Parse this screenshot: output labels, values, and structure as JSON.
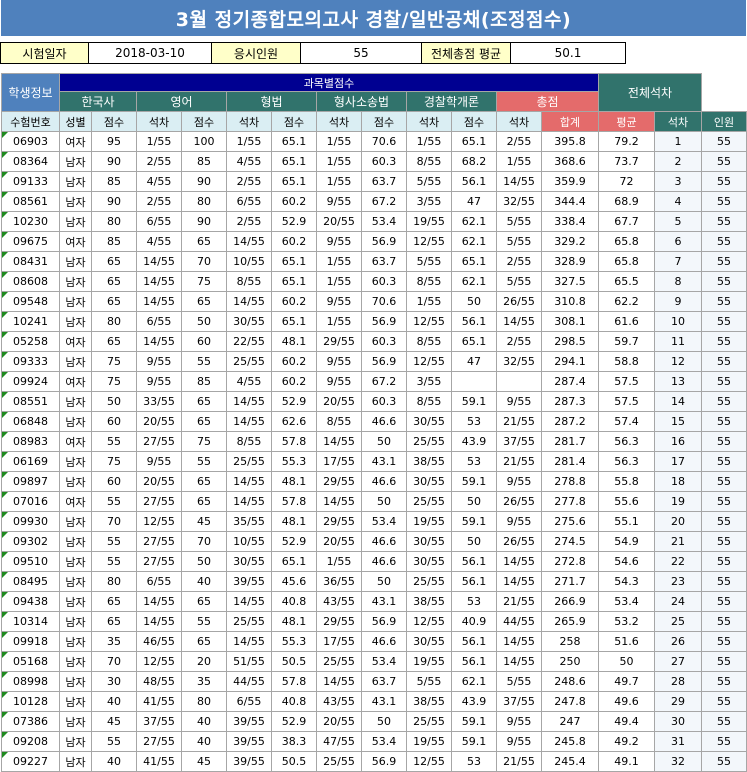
{
  "title": "3월 정기종합모의고사 경찰/일반공채(조정점수)",
  "info": {
    "exam_date_label": "시험일자",
    "exam_date": "2018-03-10",
    "count_label": "응시인원",
    "count": "55",
    "avg_label": "전체총점 평균",
    "avg": "50.1"
  },
  "headers": {
    "student_info": "학생정보",
    "subjects": "과목별점수",
    "overall_rank": "전체석차",
    "subject_names": [
      "한국사",
      "영어",
      "형법",
      "형사소송법",
      "경찰학개론"
    ],
    "total": "총점",
    "exam_no": "수험번호",
    "gender": "성별",
    "score": "점수",
    "rank": "석차",
    "sum": "합계",
    "average": "평균",
    "rank2": "석차",
    "people": "인원"
  },
  "rows": [
    [
      "06903",
      "여자",
      "95",
      "1/55",
      "100",
      "1/55",
      "65.1",
      "1/55",
      "70.6",
      "1/55",
      "65.1",
      "2/55",
      "395.8",
      "79.2",
      "1",
      "55"
    ],
    [
      "08364",
      "남자",
      "90",
      "2/55",
      "85",
      "4/55",
      "65.1",
      "1/55",
      "60.3",
      "8/55",
      "68.2",
      "1/55",
      "368.6",
      "73.7",
      "2",
      "55"
    ],
    [
      "09133",
      "남자",
      "85",
      "4/55",
      "90",
      "2/55",
      "65.1",
      "1/55",
      "63.7",
      "5/55",
      "56.1",
      "14/55",
      "359.9",
      "72",
      "3",
      "55"
    ],
    [
      "08561",
      "남자",
      "90",
      "2/55",
      "80",
      "6/55",
      "60.2",
      "9/55",
      "67.2",
      "3/55",
      "47",
      "32/55",
      "344.4",
      "68.9",
      "4",
      "55"
    ],
    [
      "10230",
      "남자",
      "80",
      "6/55",
      "90",
      "2/55",
      "52.9",
      "20/55",
      "53.4",
      "19/55",
      "62.1",
      "5/55",
      "338.4",
      "67.7",
      "5",
      "55"
    ],
    [
      "09675",
      "여자",
      "85",
      "4/55",
      "65",
      "14/55",
      "60.2",
      "9/55",
      "56.9",
      "12/55",
      "62.1",
      "5/55",
      "329.2",
      "65.8",
      "6",
      "55"
    ],
    [
      "08431",
      "남자",
      "65",
      "14/55",
      "70",
      "10/55",
      "65.1",
      "1/55",
      "63.7",
      "5/55",
      "65.1",
      "2/55",
      "328.9",
      "65.8",
      "7",
      "55"
    ],
    [
      "08608",
      "남자",
      "65",
      "14/55",
      "75",
      "8/55",
      "65.1",
      "1/55",
      "60.3",
      "8/55",
      "62.1",
      "5/55",
      "327.5",
      "65.5",
      "8",
      "55"
    ],
    [
      "09548",
      "남자",
      "65",
      "14/55",
      "65",
      "14/55",
      "60.2",
      "9/55",
      "70.6",
      "1/55",
      "50",
      "26/55",
      "310.8",
      "62.2",
      "9",
      "55"
    ],
    [
      "10241",
      "남자",
      "80",
      "6/55",
      "50",
      "30/55",
      "65.1",
      "1/55",
      "56.9",
      "12/55",
      "56.1",
      "14/55",
      "308.1",
      "61.6",
      "10",
      "55"
    ],
    [
      "05258",
      "여자",
      "65",
      "14/55",
      "60",
      "22/55",
      "48.1",
      "29/55",
      "60.3",
      "8/55",
      "65.1",
      "2/55",
      "298.5",
      "59.7",
      "11",
      "55"
    ],
    [
      "09333",
      "남자",
      "75",
      "9/55",
      "55",
      "25/55",
      "60.2",
      "9/55",
      "56.9",
      "12/55",
      "47",
      "32/55",
      "294.1",
      "58.8",
      "12",
      "55"
    ],
    [
      "09924",
      "여자",
      "75",
      "9/55",
      "85",
      "4/55",
      "60.2",
      "9/55",
      "67.2",
      "3/55",
      "",
      "",
      "287.4",
      "57.5",
      "13",
      "55"
    ],
    [
      "08551",
      "남자",
      "50",
      "33/55",
      "65",
      "14/55",
      "52.9",
      "20/55",
      "60.3",
      "8/55",
      "59.1",
      "9/55",
      "287.3",
      "57.5",
      "14",
      "55"
    ],
    [
      "06848",
      "남자",
      "60",
      "20/55",
      "65",
      "14/55",
      "62.6",
      "8/55",
      "46.6",
      "30/55",
      "53",
      "21/55",
      "287.2",
      "57.4",
      "15",
      "55"
    ],
    [
      "08983",
      "여자",
      "55",
      "27/55",
      "75",
      "8/55",
      "57.8",
      "14/55",
      "50",
      "25/55",
      "43.9",
      "37/55",
      "281.7",
      "56.3",
      "16",
      "55"
    ],
    [
      "06169",
      "남자",
      "75",
      "9/55",
      "55",
      "25/55",
      "55.3",
      "17/55",
      "43.1",
      "38/55",
      "53",
      "21/55",
      "281.4",
      "56.3",
      "17",
      "55"
    ],
    [
      "09897",
      "남자",
      "60",
      "20/55",
      "65",
      "14/55",
      "48.1",
      "29/55",
      "46.6",
      "30/55",
      "59.1",
      "9/55",
      "278.8",
      "55.8",
      "18",
      "55"
    ],
    [
      "07016",
      "여자",
      "55",
      "27/55",
      "65",
      "14/55",
      "57.8",
      "14/55",
      "50",
      "25/55",
      "50",
      "26/55",
      "277.8",
      "55.6",
      "19",
      "55"
    ],
    [
      "09930",
      "남자",
      "70",
      "12/55",
      "45",
      "35/55",
      "48.1",
      "29/55",
      "53.4",
      "19/55",
      "59.1",
      "9/55",
      "275.6",
      "55.1",
      "20",
      "55"
    ],
    [
      "09302",
      "남자",
      "55",
      "27/55",
      "70",
      "10/55",
      "52.9",
      "20/55",
      "46.6",
      "30/55",
      "50",
      "26/55",
      "274.5",
      "54.9",
      "21",
      "55"
    ],
    [
      "09510",
      "남자",
      "55",
      "27/55",
      "50",
      "30/55",
      "65.1",
      "1/55",
      "46.6",
      "30/55",
      "56.1",
      "14/55",
      "272.8",
      "54.6",
      "22",
      "55"
    ],
    [
      "08495",
      "남자",
      "80",
      "6/55",
      "40",
      "39/55",
      "45.6",
      "36/55",
      "50",
      "25/55",
      "56.1",
      "14/55",
      "271.7",
      "54.3",
      "23",
      "55"
    ],
    [
      "09438",
      "남자",
      "65",
      "14/55",
      "65",
      "14/55",
      "40.8",
      "43/55",
      "43.1",
      "38/55",
      "53",
      "21/55",
      "266.9",
      "53.4",
      "24",
      "55"
    ],
    [
      "10314",
      "남자",
      "65",
      "14/55",
      "55",
      "25/55",
      "48.1",
      "29/55",
      "56.9",
      "12/55",
      "40.9",
      "44/55",
      "265.9",
      "53.2",
      "25",
      "55"
    ],
    [
      "09918",
      "남자",
      "35",
      "46/55",
      "65",
      "14/55",
      "55.3",
      "17/55",
      "46.6",
      "30/55",
      "56.1",
      "14/55",
      "258",
      "51.6",
      "26",
      "55"
    ],
    [
      "05168",
      "남자",
      "70",
      "12/55",
      "20",
      "51/55",
      "50.5",
      "25/55",
      "53.4",
      "19/55",
      "56.1",
      "14/55",
      "250",
      "50",
      "27",
      "55"
    ],
    [
      "08998",
      "남자",
      "30",
      "48/55",
      "35",
      "44/55",
      "57.8",
      "14/55",
      "63.7",
      "5/55",
      "62.1",
      "5/55",
      "248.6",
      "49.7",
      "28",
      "55"
    ],
    [
      "10128",
      "남자",
      "40",
      "41/55",
      "80",
      "6/55",
      "40.8",
      "43/55",
      "43.1",
      "38/55",
      "43.9",
      "37/55",
      "247.8",
      "49.6",
      "29",
      "55"
    ],
    [
      "07386",
      "남자",
      "45",
      "37/55",
      "40",
      "39/55",
      "52.9",
      "20/55",
      "50",
      "25/55",
      "59.1",
      "9/55",
      "247",
      "49.4",
      "30",
      "55"
    ],
    [
      "09208",
      "남자",
      "55",
      "27/55",
      "40",
      "39/55",
      "38.3",
      "47/55",
      "53.4",
      "19/55",
      "59.1",
      "9/55",
      "245.8",
      "49.2",
      "31",
      "55"
    ],
    [
      "09227",
      "남자",
      "40",
      "41/55",
      "45",
      "39/55",
      "50.5",
      "25/55",
      "56.9",
      "12/55",
      "53",
      "21/55",
      "245.4",
      "49.1",
      "32",
      "55"
    ]
  ]
}
